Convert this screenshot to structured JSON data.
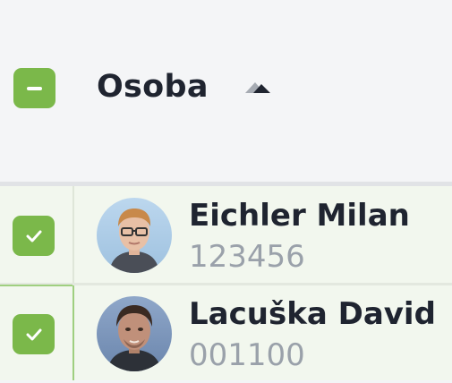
{
  "header": {
    "column_title": "Osoba",
    "select_all_state": "indeterminate",
    "sort_direction": "ascending"
  },
  "rows": [
    {
      "name": "Eichler Milan",
      "code": "123456",
      "selected": true
    },
    {
      "name": "Lacuška David",
      "code": "001100",
      "selected": true
    }
  ],
  "colors": {
    "accent_green": "#7bb84a",
    "row_background": "#f2f7ee",
    "header_background": "#f4f5f7",
    "name_text": "#1f2430",
    "code_text": "#9aa1aa"
  }
}
